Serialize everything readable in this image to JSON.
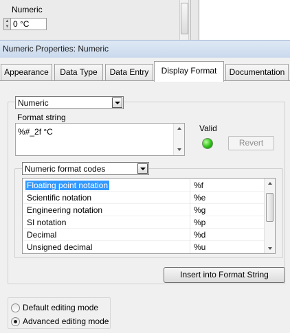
{
  "front_panel": {
    "control_label": "Numeric",
    "control_value": "0 °C"
  },
  "dialog": {
    "title": "Numeric Properties: Numeric"
  },
  "tabs": [
    {
      "label": "Appearance"
    },
    {
      "label": "Data Type"
    },
    {
      "label": "Data Entry"
    },
    {
      "label": "Display Format",
      "active": true
    },
    {
      "label": "Documentation"
    }
  ],
  "display_format": {
    "type_select": "Numeric",
    "format_string_label": "Format string",
    "format_string_value": "%#_2f °C",
    "valid_label": "Valid",
    "valid_state": "green",
    "revert_label": "Revert",
    "codes_select": "Numeric format codes",
    "codes": [
      {
        "name": "Floating point notation",
        "code": "%f",
        "selected": true
      },
      {
        "name": "Scientific notation",
        "code": "%e"
      },
      {
        "name": "Engineering notation",
        "code": "%g"
      },
      {
        "name": "SI notation",
        "code": "%p"
      },
      {
        "name": "Decimal",
        "code": "%d"
      },
      {
        "name": "Unsigned decimal",
        "code": "%u"
      }
    ],
    "insert_label": "Insert into Format String"
  },
  "editing_mode": {
    "options": [
      {
        "label": "Default editing mode",
        "selected": false
      },
      {
        "label": "Advanced editing mode",
        "selected": true
      }
    ]
  },
  "colors": {
    "selection": "#3399ff",
    "led_green": "#2fbf19",
    "title_bar": "#c9d9ec"
  }
}
